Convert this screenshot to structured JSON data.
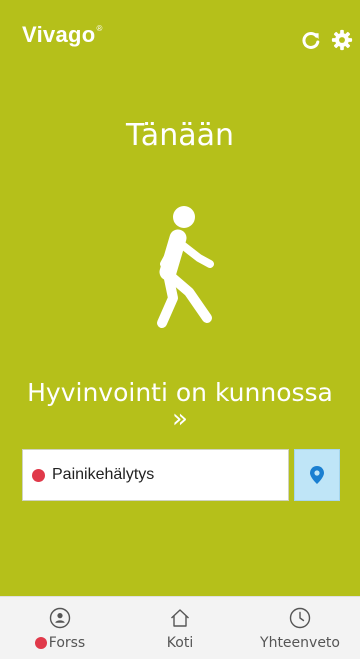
{
  "app": {
    "logo": "Vivago",
    "logo_mark": "®"
  },
  "colors": {
    "background": "#b5c01a",
    "alarm_dot": "#e0394a",
    "locate_button": "#bfe5f7",
    "locate_icon": "#1a7fd1"
  },
  "header": {
    "refresh_icon": "refresh-icon",
    "settings_icon": "gear-icon"
  },
  "main": {
    "title": "Tänään",
    "activity_icon": "walking-person-icon",
    "status_text": "Hyvinvointi on kunnossa",
    "more_glyph": "»"
  },
  "alarm": {
    "label": "Painikehälytys",
    "locate_icon": "map-pin-icon"
  },
  "bottom_nav": {
    "tabs": [
      {
        "label": "Forss",
        "icon": "person-circle-icon",
        "has_alert_dot": true
      },
      {
        "label": "Koti",
        "icon": "home-icon",
        "has_alert_dot": false
      },
      {
        "label": "Yhteenveto",
        "icon": "clock-icon",
        "has_alert_dot": false
      }
    ]
  }
}
